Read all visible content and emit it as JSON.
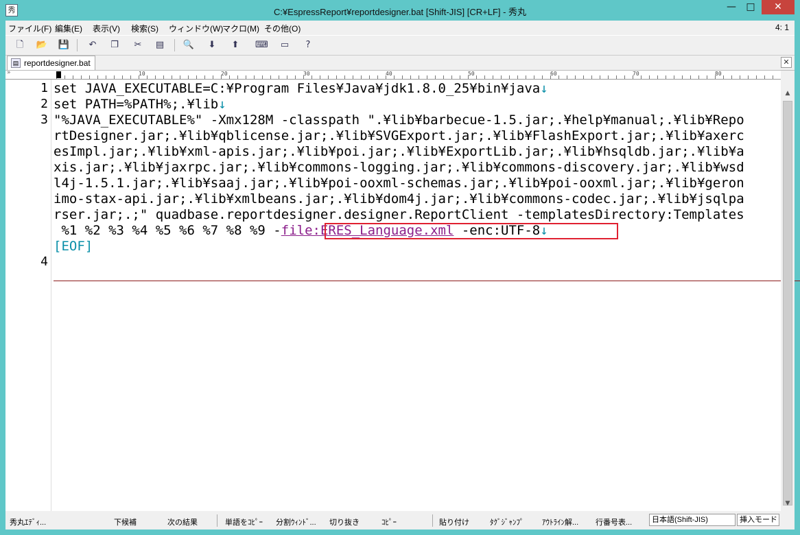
{
  "window": {
    "title": "C:¥EspressReport¥reportdesigner.bat  [Shift-JIS] [CR+LF] - 秀丸",
    "min": "—",
    "max": "□",
    "close": "✕"
  },
  "menu": {
    "items": [
      "ファイル(F)",
      "編集(E)",
      "表示(V)",
      "検索(S)",
      "ウィンドウ(W)",
      "マクロ(M)",
      "その他(O)"
    ],
    "position": "4: 1"
  },
  "toolbar": {
    "icons": [
      "new-file-icon",
      "open-folder-icon",
      "save-icon",
      "undo-icon",
      "copy-icon",
      "cut-icon",
      "paste-icon",
      "find-icon",
      "find-down-icon",
      "find-up-icon",
      "keyboard-icon",
      "window-split-icon",
      "help-icon"
    ]
  },
  "tab": {
    "label": "reportdesigner.bat",
    "close": "✕"
  },
  "ruler": {
    "lead": "»",
    "marks": [
      "10",
      "20",
      "30",
      "40",
      "50",
      "60",
      "70",
      "80"
    ]
  },
  "editor": {
    "line_numbers": [
      "1",
      "2",
      "3",
      "4"
    ],
    "rows": [
      {
        "text": "set JAVA_EXECUTABLE=C:¥Program Files¥Java¥jdk1.8.0_25¥bin¥java",
        "lf": "↓"
      },
      {
        "text": "set PATH=%PATH%;.¥lib",
        "lf": "↓"
      },
      {
        "text": "\"%JAVA_EXECUTABLE%\" -Xmx128M -classpath \".¥lib¥barbecue-1.5.jar;.¥help¥manual;.¥lib¥Repo"
      },
      {
        "text": "rtDesigner.jar;.¥lib¥qblicense.jar;.¥lib¥SVGExport.jar;.¥lib¥FlashExport.jar;.¥lib¥axerc"
      },
      {
        "text": "esImpl.jar;.¥lib¥xml-apis.jar;.¥lib¥poi.jar;.¥lib¥ExportLib.jar;.¥lib¥hsqldb.jar;.¥lib¥a"
      },
      {
        "text": "xis.jar;.¥lib¥jaxrpc.jar;.¥lib¥commons-logging.jar;.¥lib¥commons-discovery.jar;.¥lib¥wsd"
      },
      {
        "text": "l4j-1.5.1.jar;.¥lib¥saaj.jar;.¥lib¥poi-ooxml-schemas.jar;.¥lib¥poi-ooxml.jar;.¥lib¥geron"
      },
      {
        "text": "imo-stax-api.jar;.¥lib¥xmlbeans.jar;.¥lib¥dom4j.jar;.¥lib¥commons-codec.jar;.¥lib¥jsqlpa"
      },
      {
        "text": "rser.jar;.;\" quadbase.reportdesigner.designer.ReportClient -templatesDirectory:Templates"
      }
    ],
    "row10": {
      "prefix": " %1 %2 %3 %4 %5 %6 %7 %8 %9 ",
      "dash": "-",
      "file_arg": "file:ERES_Language.xml",
      "rest": " -enc:UTF-8",
      "lf": "↓"
    },
    "eof": "[EOF]"
  },
  "status": {
    "items": [
      "秀丸ｴﾃﾞｨ...",
      "下候補",
      "次の結果",
      "単語をｺﾋﾟｰ",
      "分割ｳｨﾝﾄﾞ...",
      "切り抜き",
      "ｺﾋﾟｰ",
      "貼り付け",
      "ﾀｸﾞｼﾞｬﾝﾌﾟ",
      "ｱｳﾄﾗｲﾝ解...",
      "行番号表..."
    ],
    "encoding": "日本語(Shift-JIS)",
    "mode": "挿入モード"
  }
}
